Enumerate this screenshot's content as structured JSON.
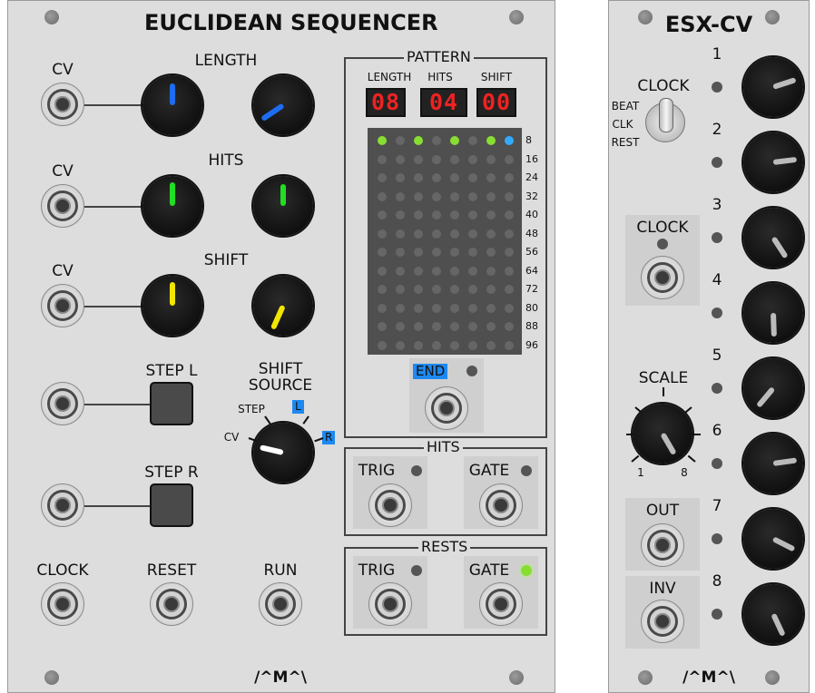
{
  "euclidean": {
    "title": "EUCLIDEAN SEQUENCER",
    "brand": "/^M^\\",
    "length_label": "LENGTH",
    "hits_label": "HITS",
    "shift_label": "SHIFT",
    "cv_label": "CV",
    "step_l_label": "STEP L",
    "step_r_label": "STEP R",
    "shift_source_label_1": "SHIFT",
    "shift_source_label_2": "SOURCE",
    "source_step": "STEP",
    "source_cv": "CV",
    "source_l": "L",
    "source_r": "R",
    "clock_label": "CLOCK",
    "reset_label": "RESET",
    "run_label": "RUN",
    "pattern": {
      "title": "PATTERN",
      "length_label": "LENGTH",
      "hits_label": "HITS",
      "shift_label": "SHIFT",
      "length_value": "08",
      "hits_value": "04",
      "shift_value": "00",
      "row_labels": [
        "8",
        "16",
        "24",
        "32",
        "40",
        "48",
        "56",
        "64",
        "72",
        "80",
        "88",
        "96"
      ],
      "first_row": [
        "green",
        "off",
        "green",
        "off",
        "green",
        "off",
        "green",
        "blue"
      ],
      "end_label": "END"
    },
    "hits_section": {
      "title": "HITS",
      "trig": "TRIG",
      "gate": "GATE"
    },
    "rests_section": {
      "title": "RESTS",
      "trig": "TRIG",
      "gate": "GATE"
    }
  },
  "esx": {
    "title": "ESX-CV",
    "brand": "/^M^\\",
    "clock_label": "CLOCK",
    "switch_beat": "BEAT",
    "switch_clk": "CLK",
    "switch_rest": "REST",
    "clock_input_label": "CLOCK",
    "scale_label": "SCALE",
    "scale_min": "1",
    "scale_max": "8",
    "out_label": "OUT",
    "inv_label": "INV",
    "channels": [
      "1",
      "2",
      "3",
      "4",
      "5",
      "6",
      "7",
      "8"
    ]
  },
  "colors": {
    "led_green": "#88dd33",
    "led_blue": "#33aaff",
    "led_off": "#666666",
    "knob_blue": "#1e6cf0",
    "knob_green": "#22dd22",
    "knob_yellow": "#f2e600",
    "knob_white": "#ffffff",
    "knob_grey": "#bbbbbb",
    "tag_blue": "#1e88f0",
    "display_red": "#ee2222"
  }
}
